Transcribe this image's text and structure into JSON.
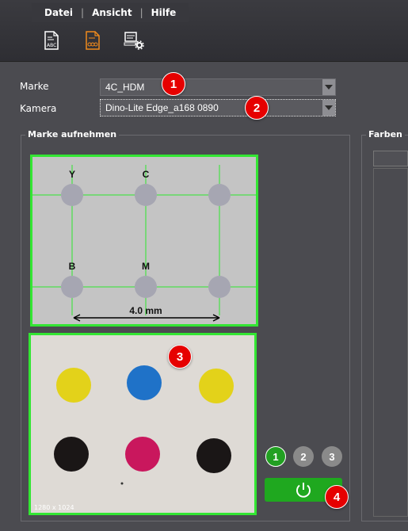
{
  "menu": {
    "items": [
      "Datei",
      "Ansicht",
      "Hilfe"
    ]
  },
  "toolbar": {
    "icons": [
      "abc-document-icon",
      "marks-document-icon",
      "computer-settings-icon"
    ],
    "accent": "#f08a1c"
  },
  "form": {
    "marke_label": "Marke",
    "marke_value": "4C_HDM",
    "kamera_label": "Kamera",
    "kamera_value": "Dino-Lite Edge_a168 0890"
  },
  "groups": {
    "capture_title": "Marke aufnehmen",
    "colors_title": "Farben"
  },
  "diagram": {
    "labels_top": [
      "Y",
      "C"
    ],
    "labels_bottom": [
      "B",
      "M"
    ],
    "dimension": "4.0 mm"
  },
  "camera": {
    "resolution": "1280 x 1024",
    "dot_colors": [
      "#e3d21a",
      "#1f72c8",
      "#e3d21a",
      "#1a1616",
      "#c9175d",
      "#1a1616"
    ]
  },
  "markers": [
    "1",
    "2",
    "3",
    "4"
  ],
  "channel_buttons": [
    "1",
    "2",
    "3"
  ],
  "colors": {
    "highlight": "#33e633",
    "button_green": "#1fa81f",
    "marker_red": "#e60000"
  }
}
